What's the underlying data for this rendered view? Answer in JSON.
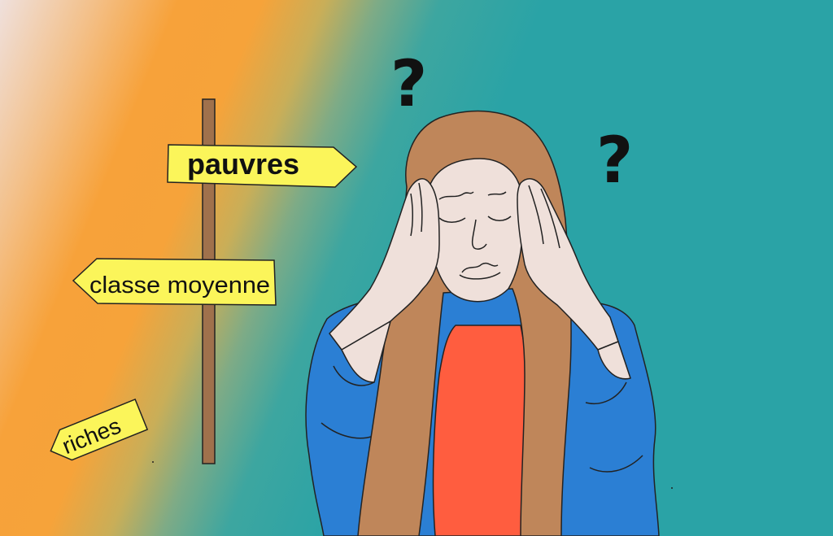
{
  "signs": {
    "top": "pauvres",
    "middle": "classe moyenne",
    "fallen": "riches"
  },
  "marks": {
    "q1": "?",
    "q2": "?"
  },
  "colors": {
    "sign_yellow": "#fbf55a",
    "pole": "#a0714c",
    "background_teal": "#2aa3a6",
    "background_orange": "#f7a23a",
    "jacket": "#2b7fd4",
    "shirt": "#ff5d3f",
    "hair": "#bf865a",
    "skin": "#efe0da"
  }
}
